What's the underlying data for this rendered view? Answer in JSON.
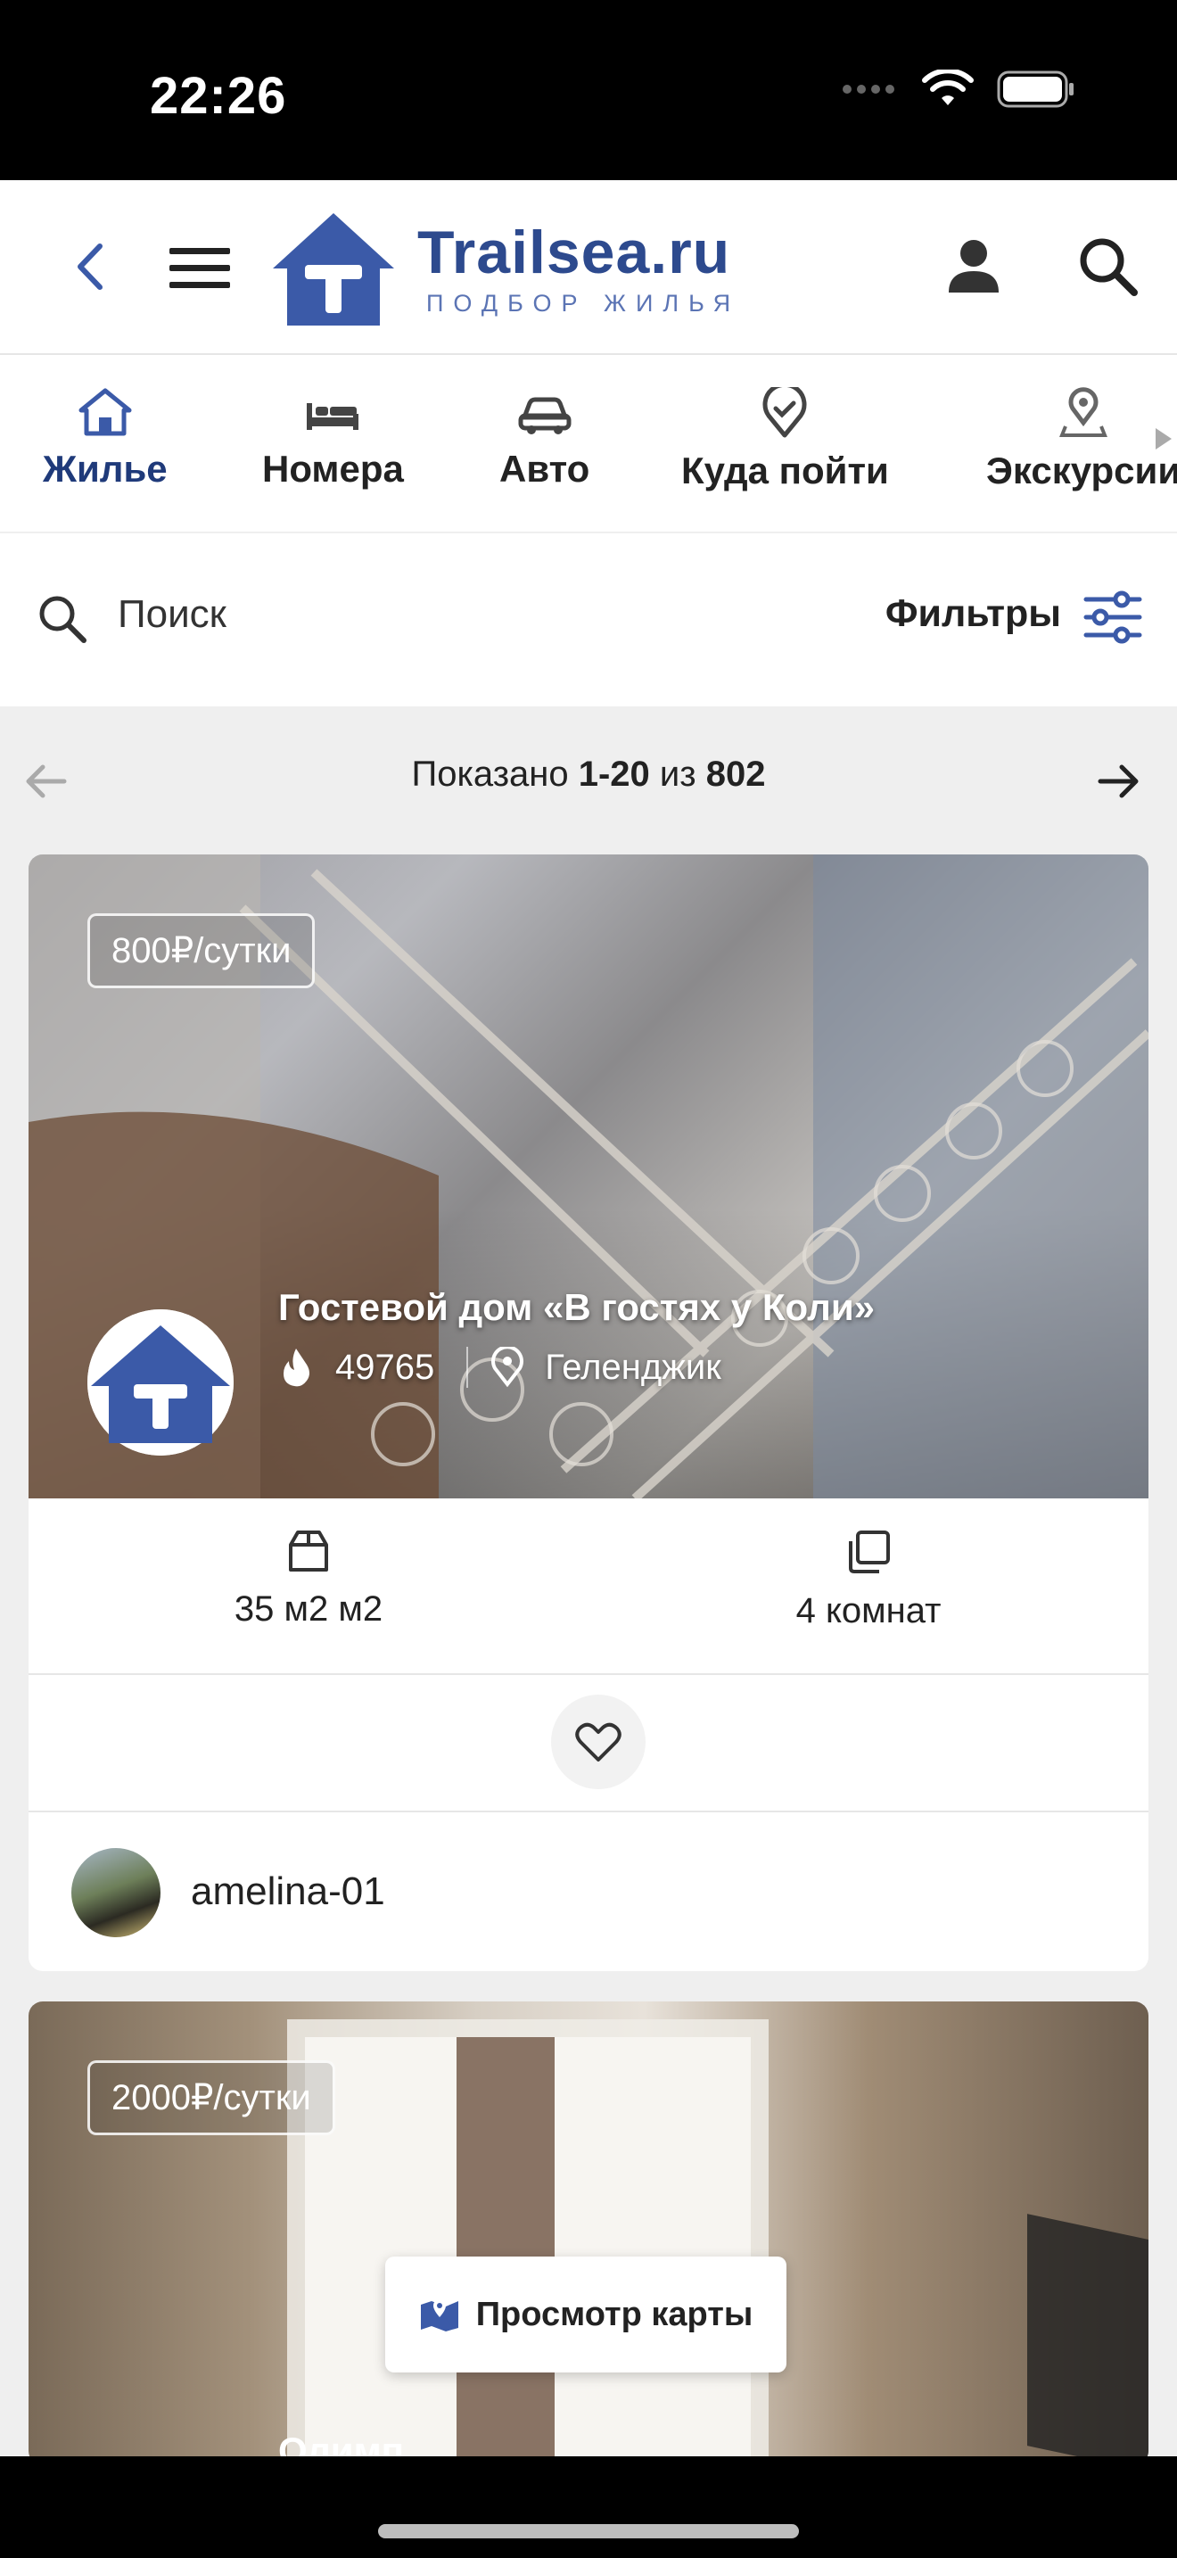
{
  "status_bar": {
    "time": "22:26"
  },
  "header": {
    "logo_title": "Trailsea.ru",
    "logo_subtitle": "ПОДБОР ЖИЛЬЯ"
  },
  "categories": [
    {
      "label": "Жилье",
      "icon": "house-icon",
      "active": true
    },
    {
      "label": "Номера",
      "icon": "bed-icon"
    },
    {
      "label": "Авто",
      "icon": "car-icon"
    },
    {
      "label": "Куда пойти",
      "icon": "location-check-icon"
    },
    {
      "label": "Экскурсии",
      "icon": "map-pin-icon"
    }
  ],
  "search": {
    "placeholder": "Поиск",
    "filters_label": "Фильтры"
  },
  "pager": {
    "prefix": "Показано",
    "range": "1-20",
    "of": "из",
    "total": "802"
  },
  "listings": [
    {
      "price": "800₽/сутки",
      "title": "Гостевой дом «В гостях у Коли»",
      "views": "49765",
      "city": "Геленджик",
      "area": "35 м2 м2",
      "rooms": "4 комнат",
      "owner": "amelina-01"
    },
    {
      "price": "2000₽/сутки",
      "title": "Олимп"
    }
  ],
  "map_button": {
    "label": "Просмотр карты"
  },
  "colors": {
    "brand": "#2d4a8e",
    "accent": "#3b5aa8"
  }
}
